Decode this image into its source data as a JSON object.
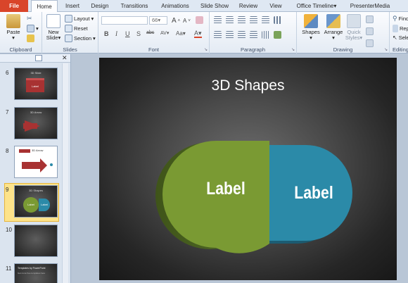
{
  "tabs": [
    "File",
    "Home",
    "Insert",
    "Design",
    "Transitions",
    "Animations",
    "Slide Show",
    "Review",
    "View",
    "Office Timeline",
    "PresenterMedia"
  ],
  "ribbon": {
    "clipboard": {
      "label": "Clipboard",
      "paste": "Paste"
    },
    "slides": {
      "label": "Slides",
      "new_slide_line1": "New",
      "new_slide_line2": "Slide",
      "layout": "Layout",
      "reset": "Reset",
      "section": "Section"
    },
    "font": {
      "label": "Font",
      "size": "66",
      "grow": "A",
      "shrink": "A",
      "bold": "B",
      "italic": "I",
      "underline": "U",
      "shadow": "S",
      "strike": "abc",
      "spacing": "AV",
      "case": "Aa",
      "color": "A"
    },
    "paragraph": {
      "label": "Paragraph"
    },
    "drawing": {
      "label": "Drawing",
      "shapes": "Shapes",
      "arrange": "Arrange",
      "quick_styles_line1": "Quick",
      "quick_styles_line2": "Styles"
    },
    "editing": {
      "label": "Editing",
      "find": "Find",
      "replace": "Replac",
      "select": "Select"
    }
  },
  "thumbnails": [
    {
      "number": "6",
      "title": "3D Slide",
      "label": "Label"
    },
    {
      "number": "7",
      "title": "3D Arrow",
      "label": ""
    },
    {
      "number": "8",
      "title": "3D Arrow",
      "label": ""
    },
    {
      "number": "9",
      "title": "3D Shapes",
      "label1": "Label",
      "label2": "Label"
    },
    {
      "number": "10",
      "title": ""
    },
    {
      "number": "11",
      "title": "Templates by PowerPoint",
      "subtitle": "Get more free templates here"
    }
  ],
  "slide": {
    "title": "3D Shapes",
    "shape1_label": "Label",
    "shape2_label": "Label"
  },
  "colors": {
    "file_tab": "#d9452a",
    "green_shape": "#7a9a33",
    "teal_shape": "#2b8aa8",
    "selected_thumb": "#fde38a"
  }
}
